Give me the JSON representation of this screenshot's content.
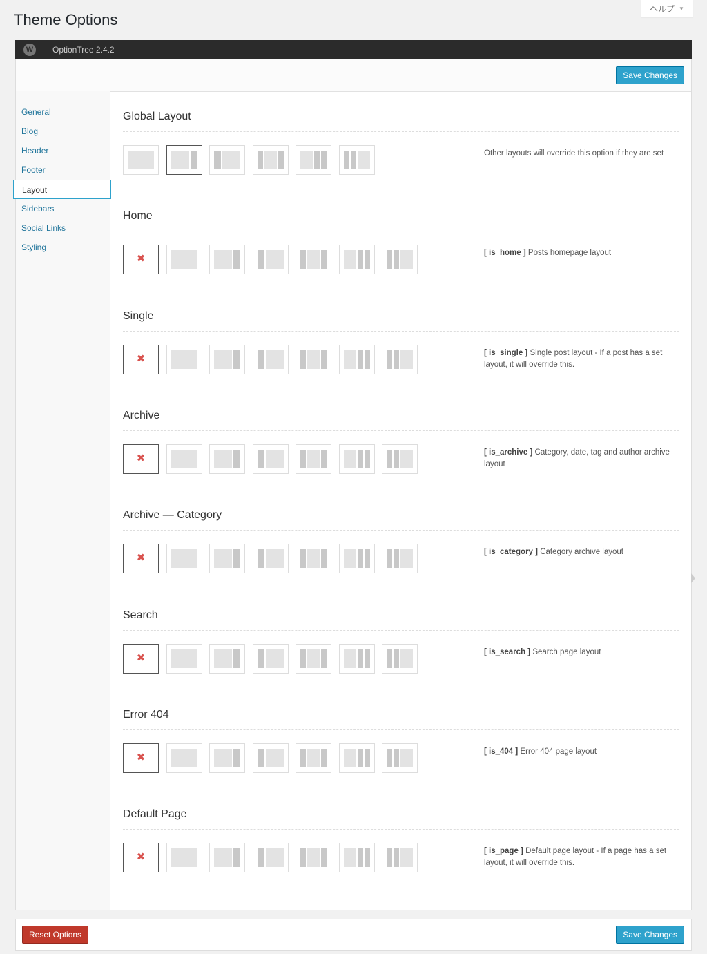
{
  "help": {
    "label": "ヘルプ",
    "arrow": "▼"
  },
  "page_title": "Theme Options",
  "topbar": {
    "logo": "W",
    "version": "OptionTree 2.4.2"
  },
  "buttons": {
    "save": "Save Changes",
    "reset": "Reset Options"
  },
  "sidebar": {
    "items": [
      {
        "label": "General"
      },
      {
        "label": "Blog"
      },
      {
        "label": "Header"
      },
      {
        "label": "Footer"
      },
      {
        "label": "Layout"
      },
      {
        "label": "Sidebars"
      },
      {
        "label": "Social Links"
      },
      {
        "label": "Styling"
      }
    ],
    "active": "Layout"
  },
  "sections": [
    {
      "title": "Global Layout",
      "tag": "",
      "desc": "Other layouts will override this option if they are set",
      "has_inherit": false,
      "selected": "1"
    },
    {
      "title": "Home",
      "tag": "[ is_home ]",
      "desc": "Posts homepage layout",
      "has_inherit": true,
      "selected": "inherit"
    },
    {
      "title": "Single",
      "tag": "[ is_single ]",
      "desc": "Single post layout - If a post has a set layout, it will override this.",
      "has_inherit": true,
      "selected": "inherit"
    },
    {
      "title": "Archive",
      "tag": "[ is_archive ]",
      "desc": "Category, date, tag and author archive layout",
      "has_inherit": true,
      "selected": "inherit"
    },
    {
      "title": "Archive — Category",
      "tag": "[ is_category ]",
      "desc": "Category archive layout",
      "has_inherit": true,
      "selected": "inherit"
    },
    {
      "title": "Search",
      "tag": "[ is_search ]",
      "desc": "Search page layout",
      "has_inherit": true,
      "selected": "inherit"
    },
    {
      "title": "Error 404",
      "tag": "[ is_404 ]",
      "desc": "Error 404 page layout",
      "has_inherit": true,
      "selected": "inherit"
    },
    {
      "title": "Default Page",
      "tag": "[ is_page ]",
      "desc": "Default page layout - If a page has a set layout, it will override this.",
      "has_inherit": true,
      "selected": "inherit"
    }
  ],
  "layout_icons": [
    {
      "name": "col-1c-icon"
    },
    {
      "name": "col-2cl-icon"
    },
    {
      "name": "col-2cr-icon"
    },
    {
      "name": "col-3cm-icon"
    },
    {
      "name": "col-3cl-icon"
    },
    {
      "name": "col-3cr-icon"
    }
  ],
  "inherit_icon": {
    "name": "inherit-x-icon",
    "glyph": "✖"
  },
  "colors": {
    "primary": "#2ea2cc",
    "danger": "#c0392b",
    "topbar": "#2b2b2b",
    "link": "#21759b"
  }
}
